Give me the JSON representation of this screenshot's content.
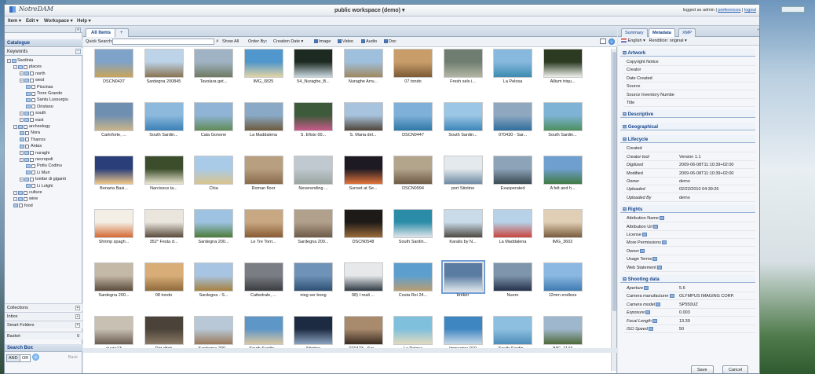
{
  "app": {
    "name": "NotreDAM",
    "workspace_title": "public workspace (demo)",
    "logged_as": "logged as admin",
    "preferences": "preferences",
    "logout": "logout"
  },
  "menu": [
    "Item",
    "Edit",
    "Workspace",
    "Help"
  ],
  "left": {
    "catalogue": "Catalogue",
    "keywords": "Keywords",
    "tree": [
      {
        "label": "Sardinia",
        "level": 0,
        "kind": "folder"
      },
      {
        "label": "places",
        "level": 1,
        "kind": "folder"
      },
      {
        "label": "north",
        "level": 2,
        "kind": "folder"
      },
      {
        "label": "west",
        "level": 2,
        "kind": "folder"
      },
      {
        "label": "Piscinas",
        "level": 3,
        "kind": "leaf"
      },
      {
        "label": "Torre Grande",
        "level": 3,
        "kind": "leaf"
      },
      {
        "label": "Santu Lussurgiu",
        "level": 3,
        "kind": "leaf"
      },
      {
        "label": "Oristano",
        "level": 3,
        "kind": "leaf"
      },
      {
        "label": "south",
        "level": 2,
        "kind": "folder"
      },
      {
        "label": "east",
        "level": 2,
        "kind": "folder"
      },
      {
        "label": "archeology",
        "level": 1,
        "kind": "folder"
      },
      {
        "label": "Nora",
        "level": 2,
        "kind": "leaf"
      },
      {
        "label": "Tharros",
        "level": 2,
        "kind": "leaf"
      },
      {
        "label": "Antas",
        "level": 2,
        "kind": "leaf"
      },
      {
        "label": "nuraghi",
        "level": 2,
        "kind": "folder"
      },
      {
        "label": "necropoli",
        "level": 2,
        "kind": "folder"
      },
      {
        "label": "Pottu Codinu",
        "level": 3,
        "kind": "leaf"
      },
      {
        "label": "Li Muri",
        "level": 3,
        "kind": "leaf"
      },
      {
        "label": "tombe di giganti",
        "level": 2,
        "kind": "folder"
      },
      {
        "label": "Li Lolghi",
        "level": 3,
        "kind": "leaf"
      },
      {
        "label": "culture",
        "level": 1,
        "kind": "folder"
      },
      {
        "label": "wine",
        "level": 1,
        "kind": "folder"
      },
      {
        "label": "food",
        "level": 1,
        "kind": "leaf"
      }
    ],
    "collections": "Collections",
    "inbox": "Inbox",
    "smart_folders": "Smart Folders",
    "basket": "Basket",
    "basket_count": "0",
    "search_box": "Search Box",
    "and": "AND",
    "or": "OR",
    "back": "Back"
  },
  "center": {
    "tab": "All Items",
    "tab_add": "+",
    "quick_search_label": "Quick Search:",
    "show_all": "Show All",
    "order_by_label": "Order By:",
    "order_by_value": "Creation Date",
    "filters": [
      "Image",
      "Video",
      "Audio",
      "Doc"
    ],
    "items": [
      {
        "caption": "DSCN0437",
        "c1": "#7fa3c8",
        "c2": "#c9a45a"
      },
      {
        "caption": "Sardegna 200845",
        "c1": "#bcd3e8",
        "c2": "#8a7452"
      },
      {
        "caption": "Tavolara get...",
        "c1": "#9fb3c4",
        "c2": "#6e7a62"
      },
      {
        "caption": "IMG_0825",
        "c1": "#4f97cc",
        "c2": "#e2d3a4"
      },
      {
        "caption": "54_Nuraghe_B...",
        "c1": "#1d2a22",
        "c2": "#c8d7df"
      },
      {
        "caption": "Nuraghe Arru...",
        "c1": "#9fc0dd",
        "c2": "#a08860"
      },
      {
        "caption": "07 tondo",
        "c1": "#c99d6a",
        "c2": "#7b5a34"
      },
      {
        "caption": "Fresh sels i...",
        "c1": "#6f7d70",
        "c2": "#b4b6a4"
      },
      {
        "caption": "La Pelosa",
        "c1": "#87b8de",
        "c2": "#3c8ab1"
      },
      {
        "caption": "Allium triqu...",
        "c1": "#2c3a22",
        "c2": "#eef0ea"
      },
      {
        "caption": "Carloforte, ...",
        "c1": "#6f8fb1",
        "c2": "#c9b48a"
      },
      {
        "caption": "South Sardin...",
        "c1": "#8cb9dc",
        "c2": "#3a7fb6"
      },
      {
        "caption": "Cala Gonone",
        "c1": "#8fb4d6",
        "c2": "#5f8a55"
      },
      {
        "caption": "La Maddalena",
        "c1": "#8aa9c6",
        "c2": "#6d5a3c"
      },
      {
        "caption": "S. Efisio 00...",
        "c1": "#3d5a3a",
        "c2": "#c85a8a"
      },
      {
        "caption": "S. Maria del...",
        "c1": "#a8c3dd",
        "c2": "#4f4338"
      },
      {
        "caption": "DSCN0447",
        "c1": "#7fb0d9",
        "c2": "#2e77a6"
      },
      {
        "caption": "South Sardin...",
        "c1": "#9cc6e6",
        "c2": "#3b86b8"
      },
      {
        "caption": "070430 - Sar...",
        "c1": "#8fa8c0",
        "c2": "#2f6d9d"
      },
      {
        "caption": "South Sardin...",
        "c1": "#7fb3d6",
        "c2": "#4b8f5e"
      },
      {
        "caption": "Bonaria Basi...",
        "c1": "#2a3f7a",
        "c2": "#f0c88a"
      },
      {
        "caption": "Narcissus ta...",
        "c1": "#3b4d2a",
        "c2": "#e9e6cf"
      },
      {
        "caption": "Chia",
        "c1": "#a9cbe8",
        "c2": "#d9c48d"
      },
      {
        "caption": "Roman floor",
        "c1": "#b89f80",
        "c2": "#8a6a4c"
      },
      {
        "caption": "Neverending ...",
        "c1": "#bfc9cf",
        "c2": "#9aa5a0"
      },
      {
        "caption": "Sunset at Se...",
        "c1": "#1e1a24",
        "c2": "#e0733a"
      },
      {
        "caption": "DSCN0994",
        "c1": "#b3a48c",
        "c2": "#6e5b45"
      },
      {
        "caption": "port Stintino",
        "c1": "#e4e9ed",
        "c2": "#6d8aa3"
      },
      {
        "caption": "Exasperated",
        "c1": "#8ca3b8",
        "c2": "#3b4a52"
      },
      {
        "caption": "A felt and h...",
        "c1": "#6f9fcf",
        "c2": "#3f7a43"
      },
      {
        "caption": "Shrimp spagh...",
        "c1": "#f3efe6",
        "c2": "#d46a34"
      },
      {
        "caption": "352° Festa d...",
        "c1": "#eae6de",
        "c2": "#5a4b3c"
      },
      {
        "caption": "Sardegna 200...",
        "c1": "#9ec3e2",
        "c2": "#4c7c39"
      },
      {
        "caption": "Le Tre Torri...",
        "c1": "#c7a882",
        "c2": "#8a5b34"
      },
      {
        "caption": "Sardegna 200...",
        "c1": "#b1a08c",
        "c2": "#6d5a48"
      },
      {
        "caption": "DSCN0548",
        "c1": "#1e1a18",
        "c2": "#9a6b3a"
      },
      {
        "caption": "South Sardin...",
        "c1": "#2b8ca8",
        "c2": "#e0e6ea"
      },
      {
        "caption": "Karalis by N...",
        "c1": "#c9dbe9",
        "c2": "#4e4a42"
      },
      {
        "caption": "La Maddalena",
        "c1": "#b6d1e8",
        "c2": "#c9443d"
      },
      {
        "caption": "IMG_3602",
        "c1": "#e0cfb4",
        "c2": "#7a5b3c"
      },
      {
        "caption": "Sardegna 200...",
        "c1": "#c4b8a6",
        "c2": "#5b4b3c"
      },
      {
        "caption": "08 tondo",
        "c1": "#d8ad78",
        "c2": "#8f6a3b"
      },
      {
        "caption": "Sardegna - S...",
        "c1": "#a7c5e2",
        "c2": "#a6803f"
      },
      {
        "caption": "Cattedrale, ...",
        "c1": "#7a7e84",
        "c2": "#3a3c3f"
      },
      {
        "caption": "nieg ser boog",
        "c1": "#6f93b8",
        "c2": "#2d4f73"
      },
      {
        "caption": "98) I reali ...",
        "c1": "#e6e8ea",
        "c2": "#2e3a44"
      },
      {
        "caption": "Costa Rei 24...",
        "c1": "#5c9fcf",
        "c2": "#b99e72"
      },
      {
        "caption": "breker",
        "c1": "#5b7ca2",
        "c2": "#d9e3ea"
      },
      {
        "caption": "Nuoro",
        "c1": "#7f95ab",
        "c2": "#24314a"
      },
      {
        "caption": "12mm endless",
        "c1": "#8ab8e2",
        "c2": "#3f7ab0"
      },
      {
        "caption": "rivata13",
        "c1": "#c8c0b2",
        "c2": "#6a5e52"
      },
      {
        "caption": "Dirt ditch",
        "c1": "#4b4239",
        "c2": "#8a7a66"
      },
      {
        "caption": "Sardegna 200...",
        "c1": "#b8c8d6",
        "c2": "#9b7a5a"
      },
      {
        "caption": "South Sardin...",
        "c1": "#5e97c7",
        "c2": "#d9c7a2"
      },
      {
        "caption": "Stintino",
        "c1": "#1d2b42",
        "c2": "#8aa2bf"
      },
      {
        "caption": "070423 - Sar...",
        "c1": "#a88a6c",
        "c2": "#3b2d22"
      },
      {
        "caption": "La Pelosa",
        "c1": "#7fc0dc",
        "c2": "#e2dac0"
      },
      {
        "caption": "Immagine 010",
        "c1": "#3e86c2",
        "c2": "#c8d8e6"
      },
      {
        "caption": "South Sardin...",
        "c1": "#8dbfe0",
        "c2": "#4d8db9"
      },
      {
        "caption": "IMG_1143",
        "c1": "#9fb7cc",
        "c2": "#4f6a3a"
      }
    ],
    "selected_index": 47
  },
  "right": {
    "tabs": [
      "Summary",
      "Metadata",
      "XMP"
    ],
    "active_tab": "Metadata",
    "language": "English",
    "rendition_label": "Rendition: original",
    "sections": [
      {
        "title": "Artwork",
        "rows": [
          {
            "k": "Copyright Notice",
            "v": ""
          },
          {
            "k": "Creator",
            "v": ""
          },
          {
            "k": "Date Created",
            "v": ""
          },
          {
            "k": "Source",
            "v": ""
          },
          {
            "k": "Source Inventory Numbe",
            "v": ""
          },
          {
            "k": "Title",
            "v": ""
          }
        ]
      },
      {
        "title": "Descriptive",
        "rows": []
      },
      {
        "title": "Geographical",
        "rows": []
      },
      {
        "title": "Lifecycle",
        "rows": [
          {
            "k": "Created",
            "v": ""
          },
          {
            "k": "Creator tool",
            "v": "Version 1.1",
            "it": true
          },
          {
            "k": "Digitized",
            "v": "2009-06-08T11:10:39+02:00",
            "it": true
          },
          {
            "k": "Modified",
            "v": "2009-06-08T11:10:39+02:00"
          },
          {
            "k": "Owner",
            "v": "demo",
            "it": true
          },
          {
            "k": "Uploaded",
            "v": "02/22/2010 04:39:26",
            "it": true
          },
          {
            "k": "Uploaded By",
            "v": "demo",
            "it": true
          }
        ]
      },
      {
        "title": "Rights",
        "rows": [
          {
            "k": "Attribution Name",
            "v": "",
            "icon": true
          },
          {
            "k": "Attribution Url",
            "v": "",
            "icon": true
          },
          {
            "k": "License",
            "v": "",
            "icon": true
          },
          {
            "k": "More Permissions",
            "v": "",
            "icon": true
          },
          {
            "k": "Owner",
            "v": "",
            "icon": true
          },
          {
            "k": "Usage Terms",
            "v": "",
            "icon": true
          },
          {
            "k": "Web Statement",
            "v": "",
            "icon": true
          }
        ]
      },
      {
        "title": "Shooting data",
        "rows": [
          {
            "k": "Aperture",
            "v": "5.6",
            "it": true,
            "icon": true
          },
          {
            "k": "Camera manufacturer",
            "v": "OLYMPUS IMAGING CORP.",
            "icon": true
          },
          {
            "k": "Camera model",
            "v": "SP550UZ",
            "it": true,
            "icon": true
          },
          {
            "k": "Exposure",
            "v": "0.003",
            "it": true,
            "icon": true
          },
          {
            "k": "Focal Length",
            "v": "13.39",
            "it": true,
            "icon": true
          },
          {
            "k": "ISO Speed",
            "v": "50",
            "it": true,
            "icon": true
          }
        ]
      }
    ],
    "save": "Save",
    "cancel": "Cancel"
  }
}
